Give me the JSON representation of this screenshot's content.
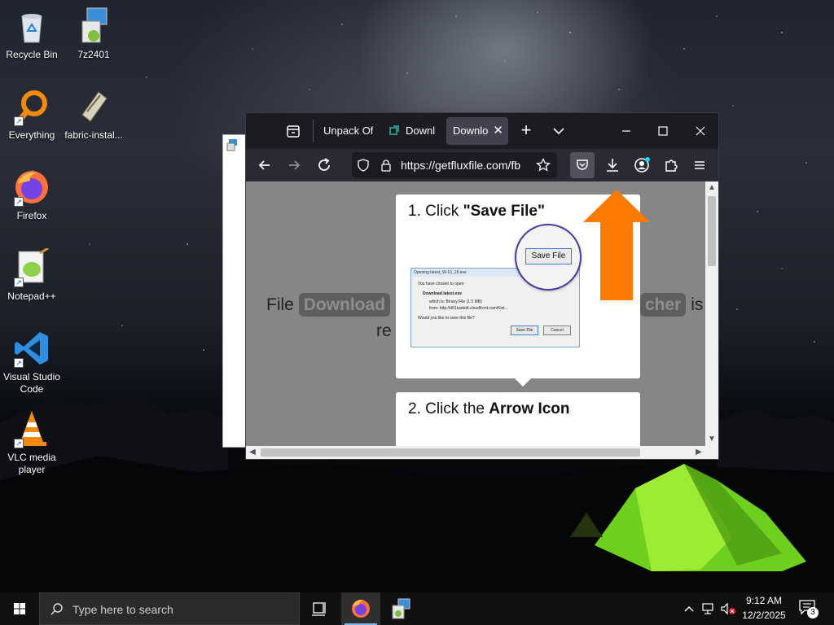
{
  "desktop": {
    "icons": [
      {
        "label": "Recycle Bin"
      },
      {
        "label": "7z2401"
      },
      {
        "label": "Everything"
      },
      {
        "label": "fabric-instal..."
      },
      {
        "label": "Firefox"
      },
      {
        "label": "Notepad++"
      },
      {
        "label": "Visual Studio Code"
      },
      {
        "label": "VLC media player"
      }
    ]
  },
  "browser": {
    "tabs": [
      {
        "label": "Unpack Of"
      },
      {
        "label": "Downl"
      },
      {
        "label": "Downlo",
        "active": true
      }
    ],
    "new_tab_symbol": "+",
    "url": "https://getfluxfile.com/fb",
    "page": {
      "bg_text_left": "File",
      "bg_pill_left": "Download",
      "bg_pill_right": "cher",
      "bg_text_right": "is",
      "bg_text_line2": "re",
      "step1_prefix": "1. Click ",
      "step1_bold": "\"Save File\"",
      "step2_prefix": "2. Click the ",
      "step2_bold": "Arrow Icon",
      "dialog": {
        "title": "Opening latest_W-10_18.exe",
        "chosen": "You have chosen to open:",
        "file": "Download latest.exe",
        "which_is": "which is:  Binary File (1.5 MB)",
        "from": "from:  http://d61kadedt.cloudfront.com/Kist...",
        "question": "Would you like to save this file?",
        "save": "Save File",
        "cancel": "Cancel"
      },
      "magnified_button": "Save File"
    }
  },
  "taskbar": {
    "search_placeholder": "Type here to search",
    "time": "9:12 AM",
    "date": "12/2/2025",
    "notification_count": "3"
  },
  "colors": {
    "arrow": "#ff7a00",
    "active_indicator": "#76b9ed"
  }
}
